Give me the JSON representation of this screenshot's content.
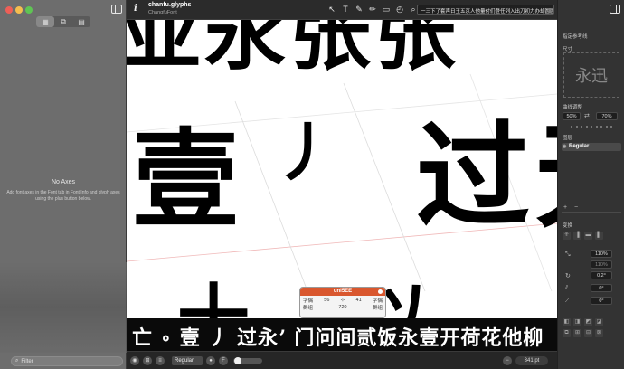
{
  "window": {
    "doc_title": "chanfu.glyphs",
    "doc_subtitle": "ChangfuFont"
  },
  "sidebar": {
    "segments": [
      "▦",
      "⧉",
      "▤"
    ],
    "no_axes_title": "No Axes",
    "no_axes_help": "Add font axes in the Font tab in Font Info and glyph axes using the plus button below.",
    "filter_placeholder": "Filter"
  },
  "toolbar": {
    "tools": [
      "↖",
      "T",
      "✎",
      "✏",
      "▭",
      "◴",
      "⌕"
    ],
    "preview_text": "一三下了套声日王五京人他量付们登任列入出刀初力办却圆圆方下日曼残木本术段离京量过永打"
  },
  "canvas": {
    "top_row": "亚永张张",
    "mid_row_1": "壹",
    "mid_row_2": "丿",
    "mid_row_3": "过",
    "mid_row_4": "无",
    "bottom_row": "十以"
  },
  "strip": {
    "text": "亡 ∘ 壹 丿 过永ʼ 门问间贰饭永壹开荷花他柳"
  },
  "glyph_info": {
    "name": "uni5EE",
    "lsb": "56",
    "rsb": "41",
    "lsb_label": "字偶",
    "rsb_label": "字偶",
    "group_left": "群组",
    "width": "720",
    "group_right": "群组"
  },
  "bottom_bar": {
    "style": "Regular",
    "zoom": "341 pt"
  },
  "right_panel": {
    "section_reference": "指定参考线",
    "section_size": "尺寸",
    "preview_glyph": "永迅",
    "section_curve": "曲线调整",
    "curve_a": "50%",
    "curve_b": "70%",
    "section_layers": "图层",
    "layer_name": "Regular",
    "section_transform": "变换",
    "scale_1": "110%",
    "scale_2": "110%",
    "angle_1": "0.2°",
    "angle_2": "0°",
    "angle_3": "0°"
  },
  "colors": {
    "accent": "#d9572e",
    "canvas_bg": "#ffffff",
    "panel_bg": "#333333"
  }
}
